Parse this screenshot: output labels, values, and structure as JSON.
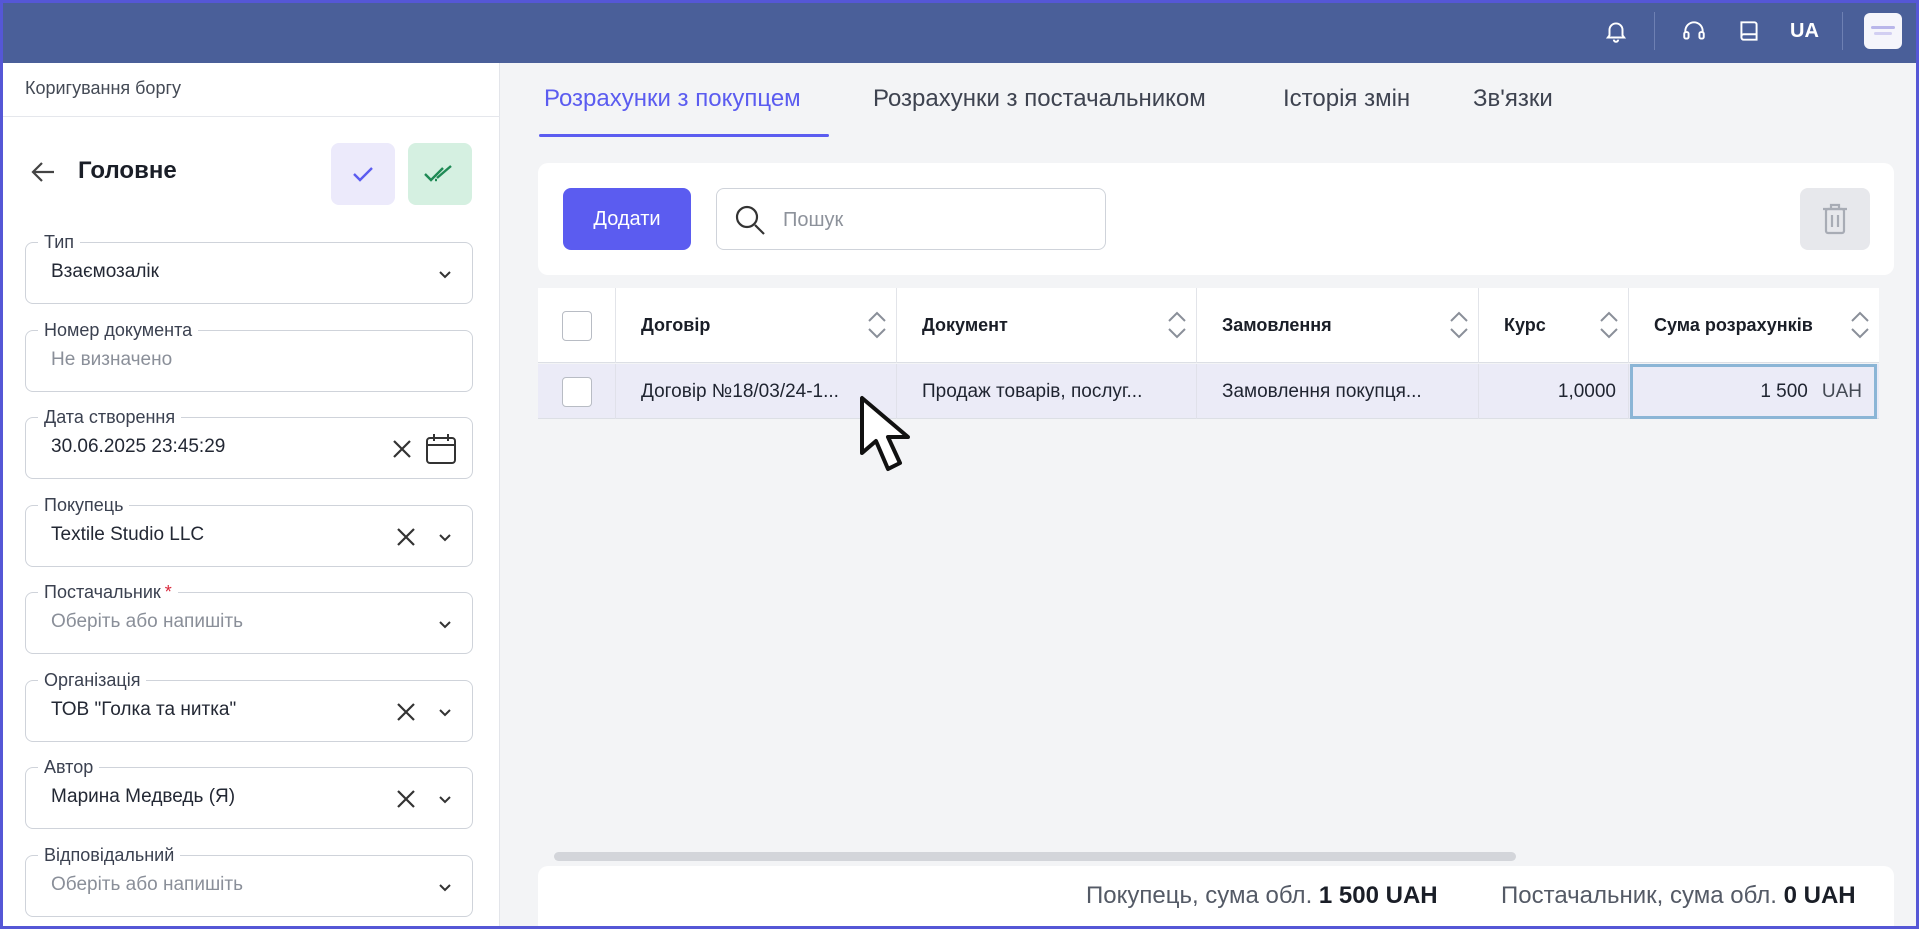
{
  "topbar": {
    "language": "UA",
    "icons": [
      "bell-icon",
      "headset-icon",
      "book-icon"
    ]
  },
  "sidebar": {
    "breadcrumb": "Коригування боргу",
    "section_title": "Головне",
    "fields": {
      "type": {
        "label": "Тип",
        "value": "Взаємозалік"
      },
      "doc_number": {
        "label": "Номер документа",
        "placeholder": "Не визначено"
      },
      "created": {
        "label": "Дата створення",
        "value": "30.06.2025 23:45:29"
      },
      "buyer": {
        "label": "Покупець",
        "value": "Textile Studio LLC"
      },
      "supplier": {
        "label": "Постачальник",
        "required": "*",
        "placeholder": "Оберіть або напишіть"
      },
      "organization": {
        "label": "Організація",
        "value": "ТОВ \"Голка та нитка\""
      },
      "author": {
        "label": "Автор",
        "value": "Марина Медведь (Я)"
      },
      "responsible": {
        "label": "Відповідальний",
        "placeholder": "Оберіть або напишіть"
      }
    }
  },
  "tabs": [
    {
      "label": "Розрахунки з покупцем",
      "active": true
    },
    {
      "label": "Розрахунки з постачальником",
      "active": false
    },
    {
      "label": "Історія змін",
      "active": false
    },
    {
      "label": "Зв'язки",
      "active": false
    }
  ],
  "toolbar": {
    "add_label": "Додати",
    "search_placeholder": "Пошук"
  },
  "table": {
    "columns": [
      "Договір",
      "Документ",
      "Замовлення",
      "Курс",
      "Сума розрахунків"
    ],
    "rows": [
      {
        "contract": "Договір №18/03/24-1...",
        "document": "Продаж товарів, послуг...",
        "order": "Замовлення покупця...",
        "rate": "1,0000",
        "amount": "1 500",
        "currency": "UAH"
      }
    ]
  },
  "footer": {
    "buyer_label": "Покупець, сума обл.",
    "buyer_value": "1 500 UAH",
    "supplier_label": "Постачальник, сума обл.",
    "supplier_value": "0 UAH"
  },
  "colors": {
    "topbar": "#4a5f99",
    "accent": "#5b5cf0",
    "confirm_bg": "#eceafb",
    "approve_bg": "#d5f0e1"
  }
}
